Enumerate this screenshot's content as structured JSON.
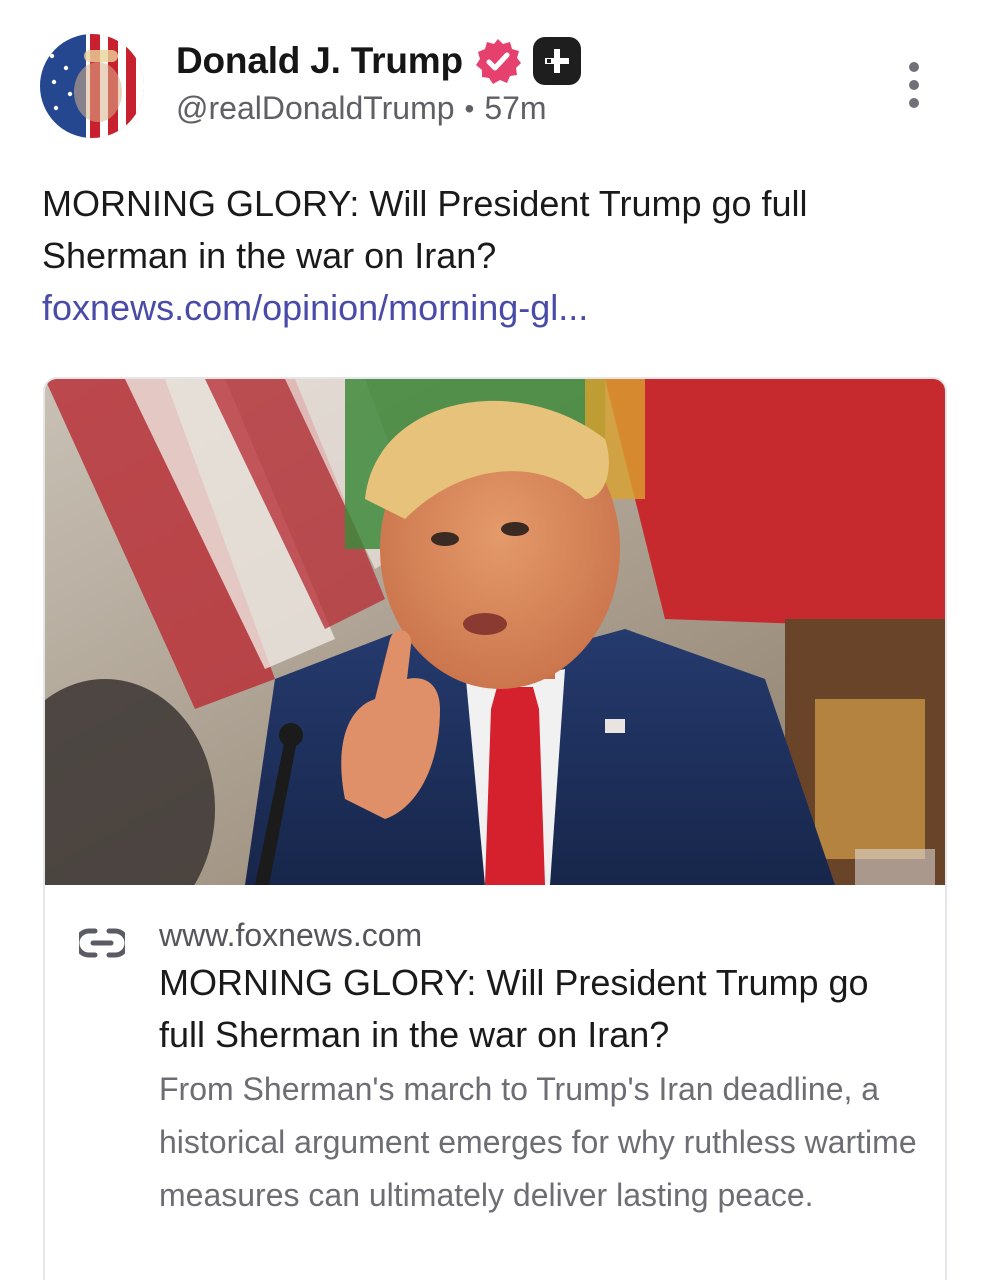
{
  "author": {
    "display_name": "Donald J. Trump",
    "handle": "@realDonaldTrump",
    "time_ago": "57m",
    "separator": "•"
  },
  "icons": {
    "verified": "verified-badge-icon",
    "plus": "plus-badge-icon",
    "more": "more-vertical-icon",
    "link": "link-icon"
  },
  "colors": {
    "verified_badge": "#e5406e",
    "link_text": "#4a4aa8",
    "secondary_text": "#5f5f66"
  },
  "post": {
    "text": "MORNING GLORY: Will President Trump go full Sherman in the war on Iran?",
    "link_text": "foxnews.com/opinion/morning-gl..."
  },
  "card": {
    "domain": "www.foxnews.com",
    "title": "MORNING GLORY: Will President Trump go full Sherman in the war on Iran?",
    "description": "From Sherman's march to Trump's Iran deadline, a historical argument emerges for why ruthless wartime measures can ultimately deliver lasting peace."
  }
}
